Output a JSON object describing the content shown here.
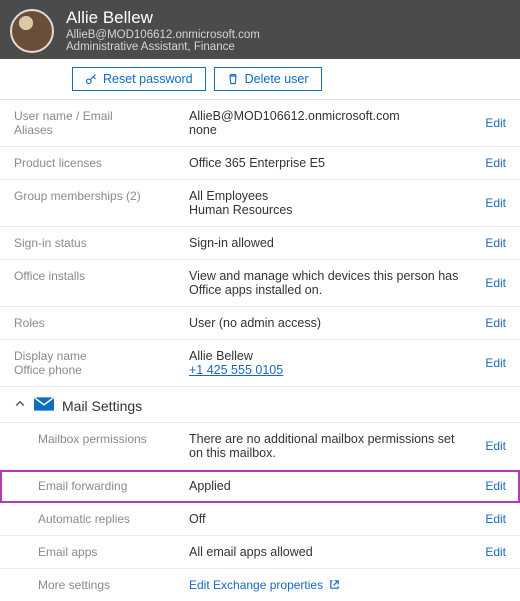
{
  "header": {
    "name": "Allie Bellew",
    "email": "AllieB@MOD106612.onmicrosoft.com",
    "role": "Administrative Assistant, Finance"
  },
  "actions": {
    "reset_password": "Reset password",
    "delete_user": "Delete user"
  },
  "edit_label": "Edit",
  "rows": {
    "username_email": {
      "label": "User name / Email",
      "sublabel": "Aliases",
      "value": "AllieB@MOD106612.onmicrosoft.com",
      "subvalue": "none"
    },
    "product_licenses": {
      "label": "Product licenses",
      "value": "Office 365 Enterprise E5"
    },
    "group_memberships": {
      "label": "Group memberships (2)",
      "value": "All Employees",
      "subvalue": "Human Resources"
    },
    "signin_status": {
      "label": "Sign-in status",
      "value": "Sign-in allowed"
    },
    "office_installs": {
      "label": "Office installs",
      "value": "View and manage which devices this person has Office apps installed on."
    },
    "roles": {
      "label": "Roles",
      "value": "User (no admin access)"
    },
    "display": {
      "label": "Display name",
      "sublabel": "Office phone",
      "value": "Allie Bellew",
      "phone": "+1 425 555 0105"
    }
  },
  "mail_section": {
    "title": "Mail Settings",
    "mailbox_permissions": {
      "label": "Mailbox permissions",
      "value": "There are no additional mailbox permissions set on this mailbox."
    },
    "email_forwarding": {
      "label": "Email forwarding",
      "value": "Applied"
    },
    "automatic_replies": {
      "label": "Automatic replies",
      "value": "Off"
    },
    "email_apps": {
      "label": "Email apps",
      "value": "All email apps allowed"
    },
    "more_settings": {
      "label": "More settings",
      "link": "Edit Exchange properties"
    }
  }
}
